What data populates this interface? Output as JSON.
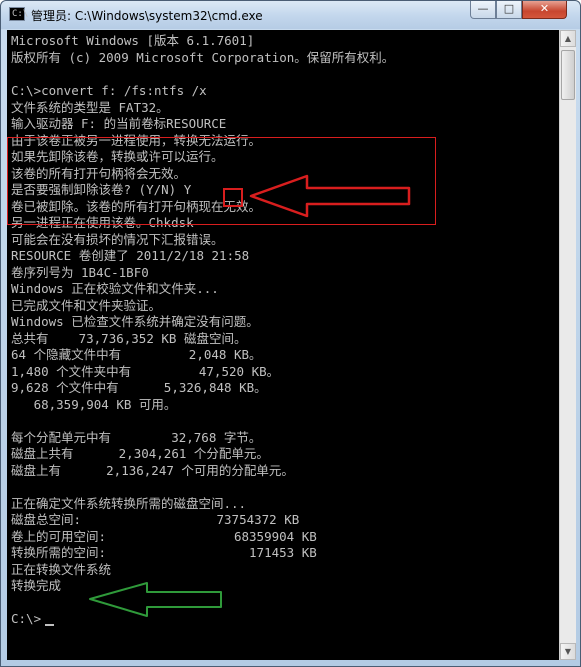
{
  "window": {
    "title": "管理员: C:\\Windows\\system32\\cmd.exe",
    "icon_text": "C:\\",
    "buttons": {
      "minimize": "—",
      "maximize": "□",
      "close": "✕"
    }
  },
  "scrollbar": {
    "up": "▲",
    "down": "▼"
  },
  "console": {
    "lines": [
      "Microsoft Windows [版本 6.1.7601]",
      "版权所有 (c) 2009 Microsoft Corporation。保留所有权利。",
      "",
      "C:\\>convert f: /fs:ntfs /x",
      "文件系统的类型是 FAT32。",
      "输入驱动器 F: 的当前卷标RESOURCE",
      "由于该卷正被另一进程使用，转换无法运行。",
      "如果先卸除该卷，转换或许可以运行。",
      "该卷的所有打开句柄将会无效。",
      "是否要强制卸除该卷? (Y/N) Y",
      "卷已被卸除。该卷的所有打开句柄现在无效。",
      "另一进程正在使用该卷。Chkdsk",
      "可能会在没有损坏的情况下汇报错误。",
      "RESOURCE 卷创建了 2011/2/18 21:58",
      "卷序列号为 1B4C-1BF0",
      "Windows 正在校验文件和文件夹...",
      "已完成文件和文件夹验证。",
      "Windows 已检查文件系统并确定没有问题。",
      "总共有    73,736,352 KB 磁盘空间。",
      "64 个隐藏文件中有         2,048 KB。",
      "1,480 个文件夹中有         47,520 KB。",
      "9,628 个文件中有      5,326,848 KB。",
      "   68,359,904 KB 可用。",
      "",
      "每个分配单元中有        32,768 字节。",
      "磁盘上共有      2,304,261 个分配单元。",
      "磁盘上有      2,136,247 个可用的分配单元。",
      "",
      "正在确定文件系统转换所需的磁盘空间...",
      "磁盘总空间:                  73754372 KB",
      "卷上的可用空间:                 68359904 KB",
      "转换所需的空间:                   171453 KB",
      "正在转换文件系统",
      "转换完成",
      "",
      "C:\\>"
    ]
  },
  "annotations": {
    "red_color": "#d81e1e",
    "green_color": "#2f9a3a"
  }
}
